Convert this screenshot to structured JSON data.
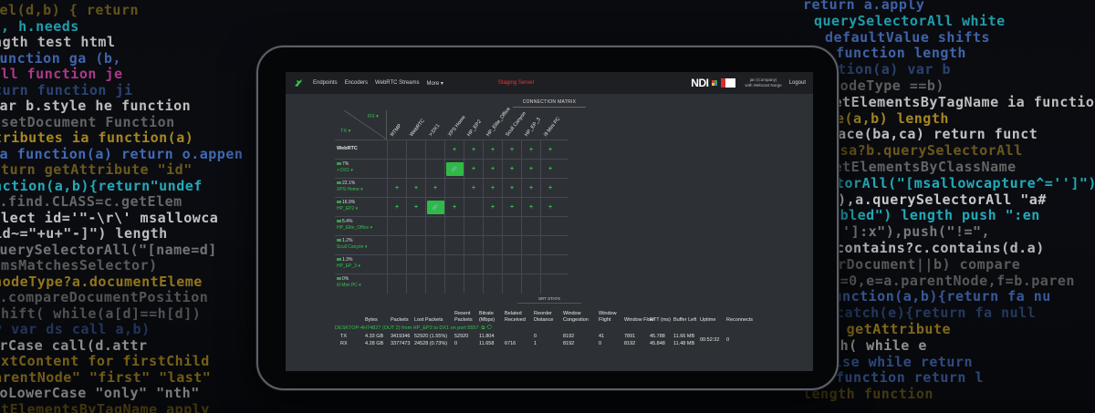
{
  "background_code": [
    {
      "text": "Sel(d,b) {  return",
      "color": "#c9a227"
    },
    {
      "text": "'], h.needs",
      "color": "#28c8d8"
    },
    {
      "text": "  length   test   html",
      "color": "#e8e8e8"
    },
    {
      "text": "function  ga  (b,",
      "color": "#4f7dd6"
    },
    {
      "text": "null  function  je",
      "color": "#d646a8"
    },
    {
      "text": "return  function  ji",
      "color": "#4f7dd6"
    },
    {
      "text": "var  b.style  he  function",
      "color": "#e8e8e8"
    },
    {
      "text": "a.setDocument  Function",
      "color": "#777777"
    },
    {
      "text": "attributes  ia  function(a)",
      "color": "#c9a227"
    },
    {
      "text": "ia  function(a)  return  o.appen",
      "color": "#4f7dd6"
    },
    {
      "text": "return  getAttribute  \"id\"",
      "color": "#c9a227"
    },
    {
      "text": "function(a,b){return\"undef",
      "color": "#28c8d8"
    },
    {
      "text": "c.find.CLASS=c.getElem",
      "color": "#777777"
    },
    {
      "text": "select id='\"-\\r\\' msallowca",
      "color": "#e8e8e8"
    },
    {
      "text": "\"[id~=\"+u+\"-]\") length",
      "color": "#e8e8e8"
    },
    {
      "text": "querySelectorAll(\"[name=d]",
      "color": "#e8e8e8"
    },
    {
      "text": "o.msMatchesSelector)",
      "color": "#777777"
    },
    {
      "text": "a.nodeType?a.documentEleme",
      "color": "#c9a227"
    },
    {
      "text": "a.compareDocumentPosition",
      "color": "#777777"
    },
    {
      "text": "nshift(  while(a[d]==h[d])",
      "color": "#777777"
    },
    {
      "text": "try var ds  call  a,b)",
      "color": "#4f7dd6"
    },
    {
      "text": "erCase  call(d.attr",
      "color": "#e8e8e8"
    },
    {
      "text": "textContent for  firstChild",
      "color": "#c9a227"
    },
    {
      "text": "\"parentNode\"  \"first\"  \"last\"",
      "color": "#c9a227"
    },
    {
      "text": "toLowerCase  \"only\"  \"nth\"",
      "color": "#e8e8e8"
    },
    {
      "text": "getElementsByTagName  apply",
      "color": "#c9a227"
    },
    {
      "text": "return  a.apply",
      "color": "#4f7dd6"
    },
    {
      "text": "querySelectorAll  white",
      "color": "#28c8d8"
    },
    {
      "text": "defaultValue  shifts",
      "color": "#4f7dd6"
    },
    {
      "text": "function  length",
      "color": "#4f7dd6"
    },
    {
      "text": "function(a)  var b",
      "color": "#4f7dd6"
    },
    {
      "text": "g.nodeType  ==b)",
      "color": "#777777"
    },
    {
      "text": "getElementsByTagName  ia  function",
      "color": "#e8e8e8"
    },
    {
      "text": "e(a,b)  length",
      "color": "#c9a227"
    },
    {
      "text": "replace(ba,ca)  return  funct",
      "color": "#e8e8e8"
    },
    {
      "text": "c.qsa?b.querySelectorAll",
      "color": "#c9a227"
    },
    {
      "text": "getElementsByClassName",
      "color": "#777777"
    },
    {
      "text": "torAll(\"[msallowcapture^='']\")",
      "color": "#28c8d8"
    },
    {
      "text": "ked\"),a.querySelectorAll  \"a#",
      "color": "#e8e8e8"
    },
    {
      "text": "enabled\") length  push  \":en",
      "color": "#28c8d8"
    },
    {
      "text": "='']:x\"),push(\"!=\",",
      "color": "#e8e8e8"
    },
    {
      "text": "contains?c.contains(d.a)",
      "color": "#e8e8e8"
    },
    {
      "text": "ownerDocument||b)  compare",
      "color": "#777777"
    },
    {
      "text": "c,d=0,e=a.parentNode,f=b.paren",
      "color": "#777777"
    },
    {
      "text": "function(a,b){return  fa  nu",
      "color": "#4f7dd6"
    },
    {
      "text": "catch(e){return  fa  null",
      "color": "#4f7dd6"
    },
    {
      "text": "ttes  getAttribute",
      "color": "#c9a227"
    },
    {
      "text": "push(  while  e",
      "color": "#e8e8e8"
    },
    {
      "text": "else  while  return",
      "color": "#4f7dd6"
    },
    {
      "text": "function  return  l",
      "color": "#4f7dd6"
    },
    {
      "text": "length  function",
      "color": "#c9a227"
    }
  ],
  "nav": {
    "items": [
      "Endpoints",
      "Encoders",
      "WebRTC Streams",
      "More ▾"
    ],
    "server": "Staging Server",
    "ndi_logo": "NDI",
    "user_line1": "jan (Company)",
    "user_line2": "with Webcast Norge",
    "logout": "Logout"
  },
  "matrix": {
    "title": "CONNECTION MATRIX",
    "rx_label": "RX ▾",
    "tx_label": "TX ▾",
    "columns": [
      "RTMP",
      "WebRTC",
      ">:DX1",
      "XPS Home",
      "HP_EP2",
      "HP_Elite_Office",
      "Scull Canyon",
      "HP_EP_3",
      "i9 Mini PC"
    ],
    "rows": [
      {
        "name": "WebRTC",
        "pct": "",
        "cells": [
          "",
          "",
          "",
          "+",
          "+",
          "+",
          "+",
          "+",
          "+"
        ]
      },
      {
        "name": ">:DX1 ▾",
        "pct": "7%",
        "cells": [
          "",
          "",
          "",
          "link",
          "+",
          "+",
          "+",
          "+",
          "+"
        ]
      },
      {
        "name": "XPS Home ▾",
        "pct": "22.1%",
        "cells": [
          "+",
          "+",
          "+",
          "",
          "+",
          "+",
          "+",
          "+",
          "+"
        ]
      },
      {
        "name": "HP_EP2 ▾",
        "pct": "16.9%",
        "cells": [
          "+",
          "+",
          "link",
          "+",
          "",
          "+",
          "+",
          "+",
          "+"
        ]
      },
      {
        "name": "HP_Elite_Office ▾",
        "pct": "5.4%",
        "cells": [
          "",
          "",
          "",
          "",
          "",
          "",
          "",
          "",
          ""
        ]
      },
      {
        "name": "Scull Canyon ▾",
        "pct": "1.2%",
        "cells": [
          "",
          "",
          "",
          "",
          "",
          "",
          "",
          "",
          ""
        ]
      },
      {
        "name": "HP_EP_3 ▾",
        "pct": "1.3%",
        "cells": [
          "",
          "",
          "",
          "",
          "",
          "",
          "",
          "",
          ""
        ]
      },
      {
        "name": "i9 Mini PC ▾",
        "pct": "0%",
        "cells": [
          "",
          "",
          "",
          "",
          "",
          "",
          "",
          "",
          ""
        ]
      }
    ]
  },
  "srt": {
    "title": "SRT STATS",
    "headers": [
      "",
      "Bytes",
      "Packets",
      "Lost Packets",
      "Resent Packets",
      "Bitrate (Mbps)",
      "Belated Received",
      "Reorder Distance",
      "Window Congestion",
      "Window Flight",
      "Window Flow",
      "RTT (ms)",
      "Buffer Left",
      "Uptime",
      "Reconnects"
    ],
    "connection": "DESKTOP-4H74827 (OUT 2) from HP_EP2 to DX1 on port 5557",
    "rows": [
      [
        "TX",
        "4.33 GB",
        "3419346",
        "52920 (1.55%)",
        "52920",
        "11.804",
        "",
        "0",
        "8192",
        "41",
        "7891",
        "45.788",
        "11.66 MB"
      ],
      [
        "RX",
        "4.28 GB",
        "3377473",
        "24528 (0.73%)",
        "0",
        "11.658",
        "6716",
        "1",
        "8192",
        "0",
        "8192",
        "45.848",
        "11.48 MB"
      ]
    ],
    "uptime": "00:52:32",
    "reconnects": "0"
  }
}
